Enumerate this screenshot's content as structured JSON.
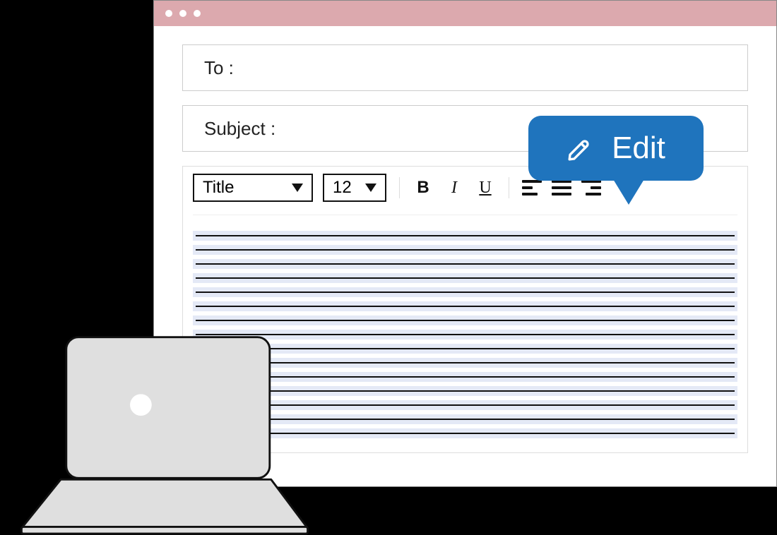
{
  "fields": {
    "to_label": "To :",
    "subject_label": "Subject :"
  },
  "toolbar": {
    "style_select": "Title",
    "size_select": "12",
    "bold": "B",
    "italic": "I",
    "underline": "U"
  },
  "bubble": {
    "label": "Edit"
  },
  "body": {
    "line_count": 15
  },
  "colors": {
    "titlebar": "#dca9ae",
    "bubble": "#1f74bd",
    "line_bg": "#e4e9f6"
  }
}
